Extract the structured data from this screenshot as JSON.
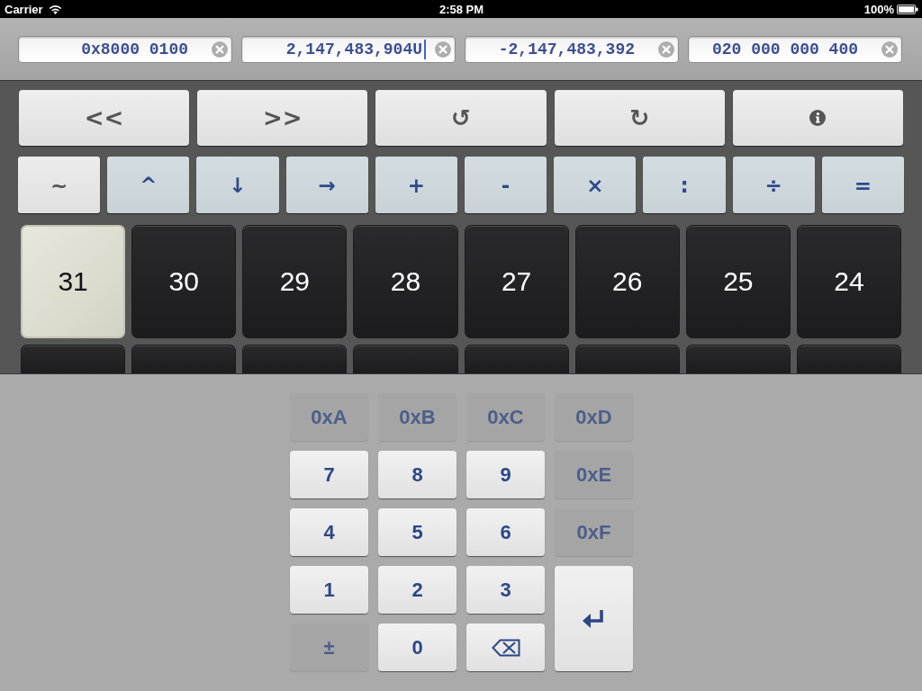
{
  "status_bar": {
    "carrier": "Carrier",
    "time": "2:58 PM",
    "battery": "100%"
  },
  "fields": [
    {
      "value": "0x8000 0100",
      "focused": false
    },
    {
      "value": "2,147,483,904U",
      "focused": true
    },
    {
      "value": "-2,147,483,392",
      "focused": false
    },
    {
      "value": "020 000 000 400",
      "focused": false
    }
  ],
  "function_keys": [
    {
      "kind": "text",
      "label": "<<"
    },
    {
      "kind": "text",
      "label": ">>"
    },
    {
      "kind": "text",
      "label": "↺"
    },
    {
      "kind": "text",
      "label": "↻"
    },
    {
      "kind": "info"
    }
  ],
  "operator_keys": [
    {
      "kind": "unary",
      "label": "~"
    },
    {
      "kind": "binary",
      "label": "^"
    },
    {
      "kind": "binary",
      "label": "↓"
    },
    {
      "kind": "binary",
      "label": "→"
    },
    {
      "kind": "binary",
      "label": "+"
    },
    {
      "kind": "binary",
      "label": "-"
    },
    {
      "kind": "binary",
      "label": "×"
    },
    {
      "kind": "binary",
      "label": ":"
    },
    {
      "kind": "binary",
      "label": "÷"
    },
    {
      "kind": "binary",
      "label": "="
    }
  ],
  "bit_rows": [
    [
      {
        "label": "31",
        "on": true
      },
      {
        "label": "30",
        "on": false
      },
      {
        "label": "29",
        "on": false
      },
      {
        "label": "28",
        "on": false
      },
      {
        "label": "27",
        "on": false
      },
      {
        "label": "26",
        "on": false
      },
      {
        "label": "25",
        "on": false
      },
      {
        "label": "24",
        "on": false
      }
    ],
    [
      {
        "on": false
      },
      {
        "on": false
      },
      {
        "on": false
      },
      {
        "on": false
      },
      {
        "on": false
      },
      {
        "on": false
      },
      {
        "on": false
      },
      {
        "on": false
      }
    ]
  ],
  "keypad": {
    "keys": [
      {
        "kind": "text",
        "label": "0xA",
        "disabled": true
      },
      {
        "kind": "text",
        "label": "0xB",
        "disabled": true
      },
      {
        "kind": "text",
        "label": "0xC",
        "disabled": true
      },
      {
        "kind": "text",
        "label": "0xD",
        "disabled": true
      },
      {
        "kind": "text",
        "label": "7",
        "disabled": false
      },
      {
        "kind": "text",
        "label": "8",
        "disabled": false
      },
      {
        "kind": "text",
        "label": "9",
        "disabled": false
      },
      {
        "kind": "text",
        "label": "0xE",
        "disabled": true
      },
      {
        "kind": "text",
        "label": "4",
        "disabled": false
      },
      {
        "kind": "text",
        "label": "5",
        "disabled": false
      },
      {
        "kind": "text",
        "label": "6",
        "disabled": false
      },
      {
        "kind": "text",
        "label": "0xF",
        "disabled": true
      },
      {
        "kind": "text",
        "label": "1",
        "disabled": false
      },
      {
        "kind": "text",
        "label": "2",
        "disabled": false
      },
      {
        "kind": "text",
        "label": "3",
        "disabled": false
      },
      {
        "kind": "enter",
        "disabled": false
      },
      {
        "kind": "text",
        "label": "±",
        "disabled": true
      },
      {
        "kind": "text",
        "label": "0",
        "disabled": false
      },
      {
        "kind": "backspace",
        "disabled": false
      }
    ]
  }
}
